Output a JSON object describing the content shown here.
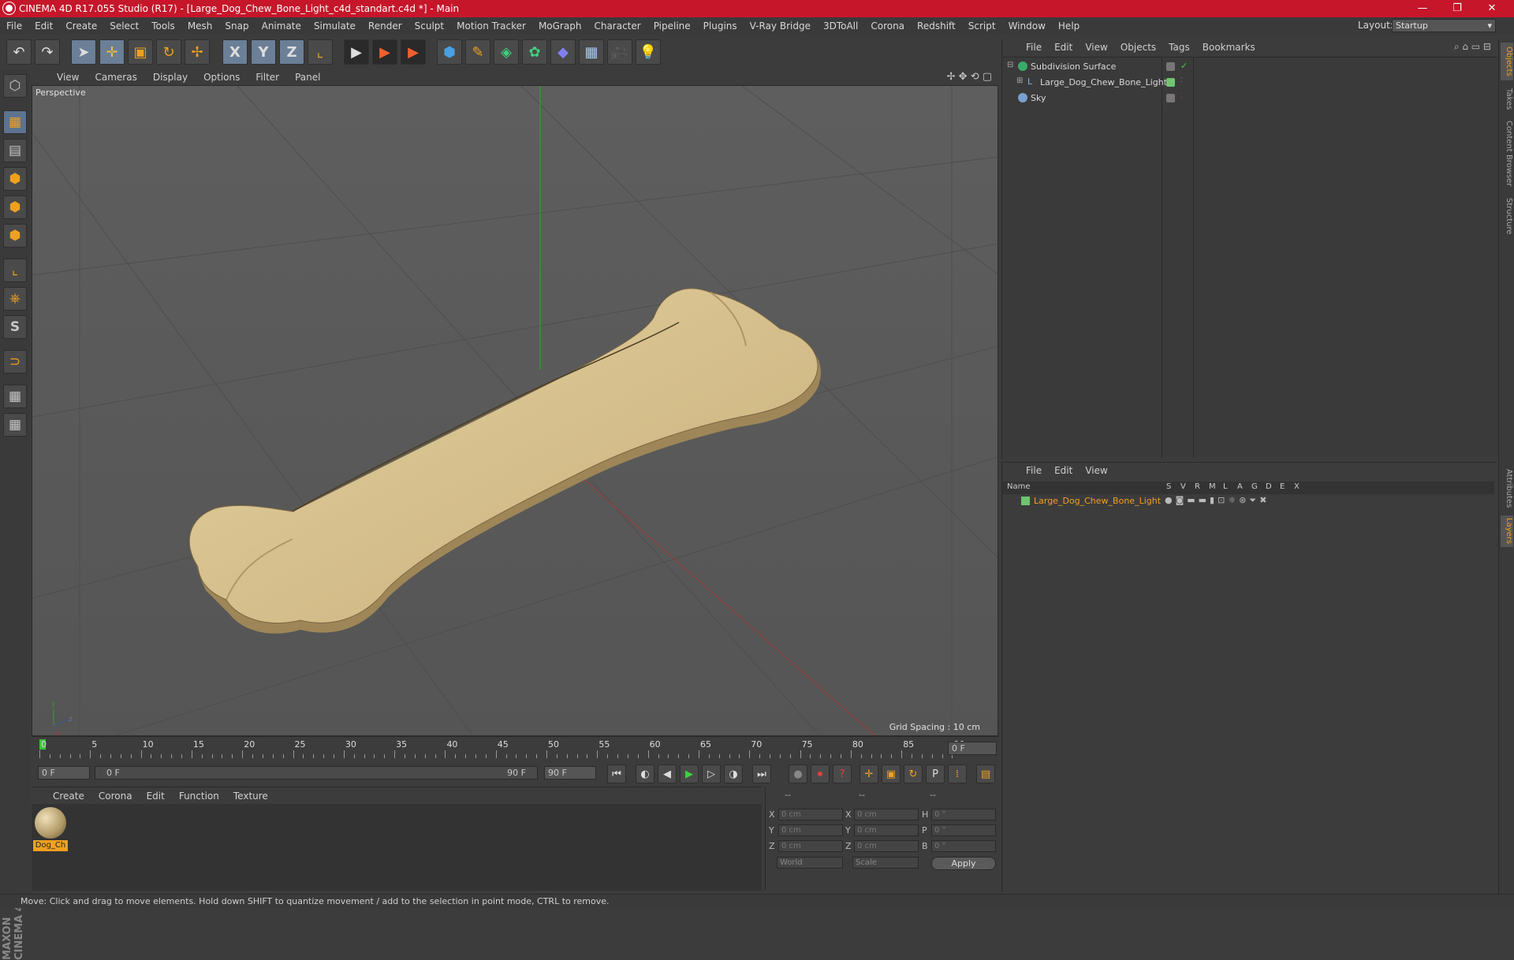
{
  "window": {
    "title": "CINEMA 4D R17.055 Studio (R17) - [Large_Dog_Chew_Bone_Light_c4d_standart.c4d *] - Main",
    "minimize": "—",
    "maximize": "❐",
    "close": "✕"
  },
  "menu": [
    "File",
    "Edit",
    "Create",
    "Select",
    "Tools",
    "Mesh",
    "Snap",
    "Animate",
    "Simulate",
    "Render",
    "Sculpt",
    "Motion Tracker",
    "MoGraph",
    "Character",
    "Pipeline",
    "Plugins",
    "V-Ray Bridge",
    "3DToAll",
    "Corona",
    "Redshift",
    "Script",
    "Window",
    "Help"
  ],
  "layout": {
    "label": "Layout:",
    "value": "Startup"
  },
  "toolbar": {
    "undo": "↶",
    "redo": "↷",
    "select": "➤",
    "move": "✛",
    "scale": "▣",
    "rotate": "↻",
    "transform": "✢",
    "x": "X",
    "y": "Y",
    "z": "Z",
    "coord": "⌞",
    "render_view": "▶",
    "render": "▶",
    "render_settings": "▶",
    "cube": "⬢",
    "pen": "✎",
    "nurbs": "◈",
    "array": "✿",
    "deformer": "◆",
    "floor": "▦",
    "camera": "🎥",
    "light": "💡"
  },
  "lefttools": [
    "⬡",
    "▦",
    "▤",
    "⬢",
    "⬢",
    "⬢",
    "⌞",
    "⎈",
    "S",
    "⊃",
    "▦",
    "▦"
  ],
  "viewport": {
    "menus": [
      "View",
      "Cameras",
      "Display",
      "Options",
      "Filter",
      "Panel"
    ],
    "label": "Perspective",
    "grid_spacing": "Grid Spacing : 10 cm",
    "nav_icons": "✢ ✥ ⟲ ▢"
  },
  "timeline": {
    "ticks": [
      "0",
      "5",
      "10",
      "15",
      "20",
      "25",
      "30",
      "35",
      "40",
      "45",
      "50",
      "55",
      "60",
      "65",
      "70",
      "75",
      "80",
      "85",
      "90"
    ],
    "current_frame": "0 F"
  },
  "transport": {
    "start": "0 F",
    "range_start": "0 F",
    "range_end": "90 F",
    "end": "90 F",
    "buttons": [
      "⏮",
      "◐",
      "◀",
      "▶",
      "▷",
      "◑",
      "⏭"
    ]
  },
  "materials": {
    "menus": [
      "Create",
      "Corona",
      "Edit",
      "Function",
      "Texture"
    ],
    "items": [
      {
        "label": "Dog_Ch"
      }
    ]
  },
  "coords": {
    "header": [
      "--",
      "--",
      "--"
    ],
    "rows": [
      {
        "a": "X",
        "av": "0 cm",
        "b": "X",
        "bv": "0 cm",
        "c": "H",
        "cv": "0 °"
      },
      {
        "a": "Y",
        "av": "0 cm",
        "b": "Y",
        "bv": "0 cm",
        "c": "P",
        "cv": "0 °"
      },
      {
        "a": "Z",
        "av": "0 cm",
        "b": "Z",
        "bv": "0 cm",
        "c": "B",
        "cv": "0 °"
      }
    ],
    "mode": "World",
    "scale": "Scale",
    "apply": "Apply"
  },
  "objects": {
    "menus": [
      "File",
      "Edit",
      "View",
      "Objects",
      "Tags",
      "Bookmarks"
    ],
    "items": [
      {
        "name": "Subdivision Surface"
      },
      {
        "name": "Large_Dog_Chew_Bone_Light"
      },
      {
        "name": "Sky"
      }
    ]
  },
  "layers": {
    "menus": [
      "File",
      "Edit",
      "View"
    ],
    "header": {
      "name": "Name",
      "cols": [
        "S",
        "V",
        "R",
        "M",
        "L",
        "A",
        "G",
        "D",
        "E",
        "X"
      ]
    },
    "items": [
      {
        "name": "Large_Dog_Chew_Bone_Light"
      }
    ]
  },
  "right_tabs": [
    "Objects",
    "Takes",
    "Content Browser",
    "Structure",
    "Attributes",
    "Layers"
  ],
  "branding": "MAXON CINEMA 4D",
  "status": "Move: Click and drag to move elements. Hold down SHIFT to quantize movement / add to the selection in point mode, CTRL to remove.",
  "colors": {
    "accent": "#c5162a",
    "bone": "#d6c08e",
    "layer_green": "#6fc46f",
    "highlight": "#f0a020"
  }
}
